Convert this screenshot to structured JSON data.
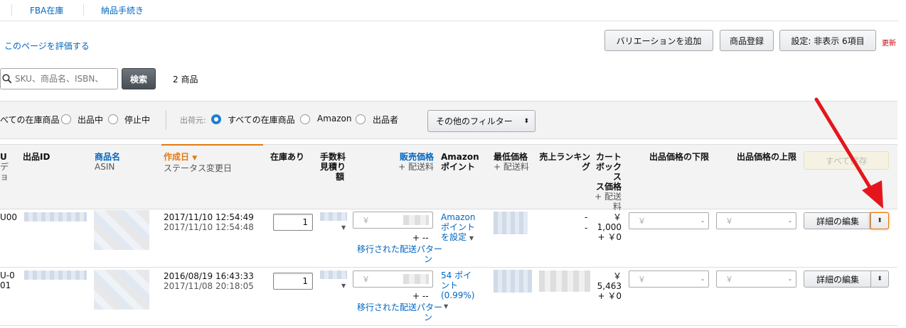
{
  "nav": {
    "items": [
      "FBA在庫",
      "納品手続き"
    ]
  },
  "feedback_link": "このページを評価する",
  "toolbar": {
    "add_variation": "バリエーションを追加",
    "register_product": "商品登録",
    "settings": "設定: 非表示 6項目",
    "update": "更新"
  },
  "search": {
    "placeholder": "SKU、商品名、ISBN、",
    "button": "検索",
    "count": "2 商品"
  },
  "filters": {
    "status_group": [
      {
        "label": "べての在庫商品",
        "selected": false
      },
      {
        "label": "出品中",
        "selected": false
      },
      {
        "label": "停止中",
        "selected": false
      }
    ],
    "ship_from_label": "出荷元:",
    "ship_from": [
      {
        "label": "すべての在庫商品",
        "selected": true
      },
      {
        "label": "Amazon",
        "selected": false
      },
      {
        "label": "出品者",
        "selected": false
      }
    ],
    "other_filters": "その他のフィルター"
  },
  "columns": {
    "sku_partial": [
      "U",
      "デ",
      "ョ"
    ],
    "listing_id": "出品ID",
    "product_name": "商品名",
    "asin": "ASIN",
    "created": "作成日",
    "status_changed": "ステータス変更日",
    "in_stock": "在庫あり",
    "fee_estimate": [
      "手数料",
      "見積り",
      "額"
    ],
    "sale_price": "販売価格",
    "plus_shipping": "+ 配送料",
    "amazon_points": [
      "Amazon",
      "ポイント"
    ],
    "lowest_price": "最低価格",
    "lowest_shipping": "+ 配送料",
    "sales_rank": [
      "売上ランキン",
      "グ"
    ],
    "cart_box": [
      "カート",
      "ボックス",
      "ス価格",
      "+ 配送",
      "料"
    ],
    "price_min": "出品価格の下限",
    "price_max": "出品価格の上限",
    "save_all": "すべて保存"
  },
  "rows": [
    {
      "sku_partial": "U00",
      "created": "2017/11/10 12:54:49",
      "status_changed": "2017/11/10 12:54:48",
      "qty": "1",
      "price_prefix": "￥",
      "shipping": "+ --",
      "shipping_pattern": [
        "移行された配送パター",
        "ン"
      ],
      "points": [
        "Amazon",
        "ポイント",
        "を設定"
      ],
      "rank": [
        "-",
        "-"
      ],
      "cart_price": [
        "￥",
        "1,000",
        "+ ￥0"
      ],
      "min_prefix": "￥",
      "max_prefix": "￥",
      "dash": "-",
      "edit": "詳細の編集"
    },
    {
      "sku_partial": "U-0",
      "sku_partial2": "01",
      "created": "2016/08/19 16:43:33",
      "status_changed": "2017/11/08 20:18:05",
      "qty": "1",
      "price_prefix": "￥",
      "shipping": "+ --",
      "shipping_pattern": [
        "移行された配送パター",
        "ン"
      ],
      "points": [
        "54 ポイ",
        "ント",
        "(0.99%)"
      ],
      "cart_price": [
        "￥",
        "5,463",
        "+ ￥0"
      ],
      "min_prefix": "￥",
      "max_prefix": "￥",
      "dash": "-",
      "edit": "詳細の編集"
    }
  ],
  "accent": {
    "link": "#0066c0",
    "sort_orange": "#e47911",
    "update_red": "#c40000",
    "arrow_red": "#e4161c"
  }
}
